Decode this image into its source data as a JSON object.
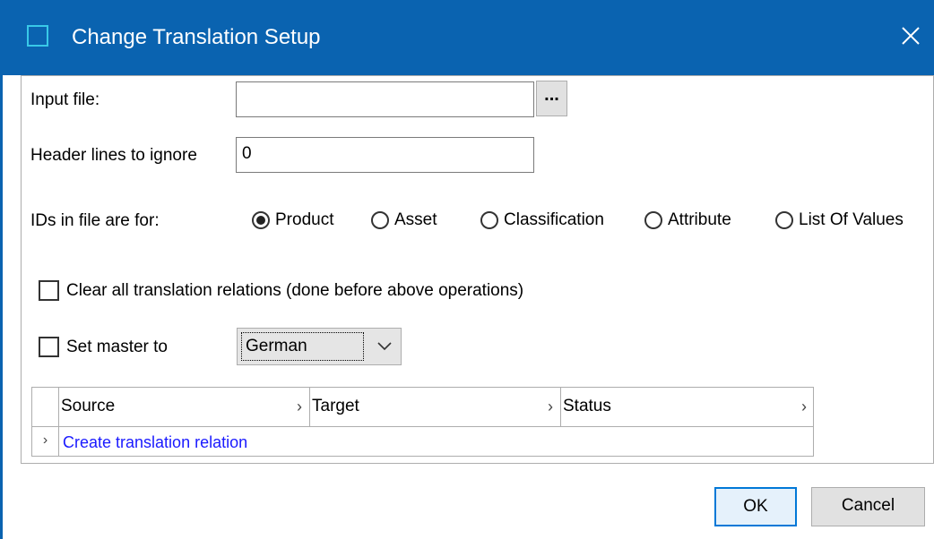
{
  "window": {
    "title": "Change Translation Setup"
  },
  "form": {
    "input_file_label": "Input file:",
    "input_file_value": "",
    "browse_label": "...",
    "header_lines_label": "Header lines to ignore",
    "header_lines_value": "0",
    "ids_label": "IDs in file are for:",
    "radio_options": [
      {
        "label": "Product",
        "checked": true
      },
      {
        "label": "Asset",
        "checked": false
      },
      {
        "label": "Classification",
        "checked": false
      },
      {
        "label": "Attribute",
        "checked": false
      },
      {
        "label": "List Of Values",
        "checked": false
      }
    ],
    "clear_relations_label": "Clear all translation relations (done before above operations)",
    "clear_relations_checked": false,
    "set_master_label": "Set master to",
    "set_master_checked": false,
    "master_language": "German"
  },
  "grid": {
    "columns": [
      "Source",
      "Target",
      "Status"
    ],
    "action_row_label": "Create translation relation"
  },
  "buttons": {
    "ok": "OK",
    "cancel": "Cancel"
  },
  "colors": {
    "titlebar": "#0a63b0",
    "link": "#1a1aff",
    "ok_border": "#0078d7"
  }
}
